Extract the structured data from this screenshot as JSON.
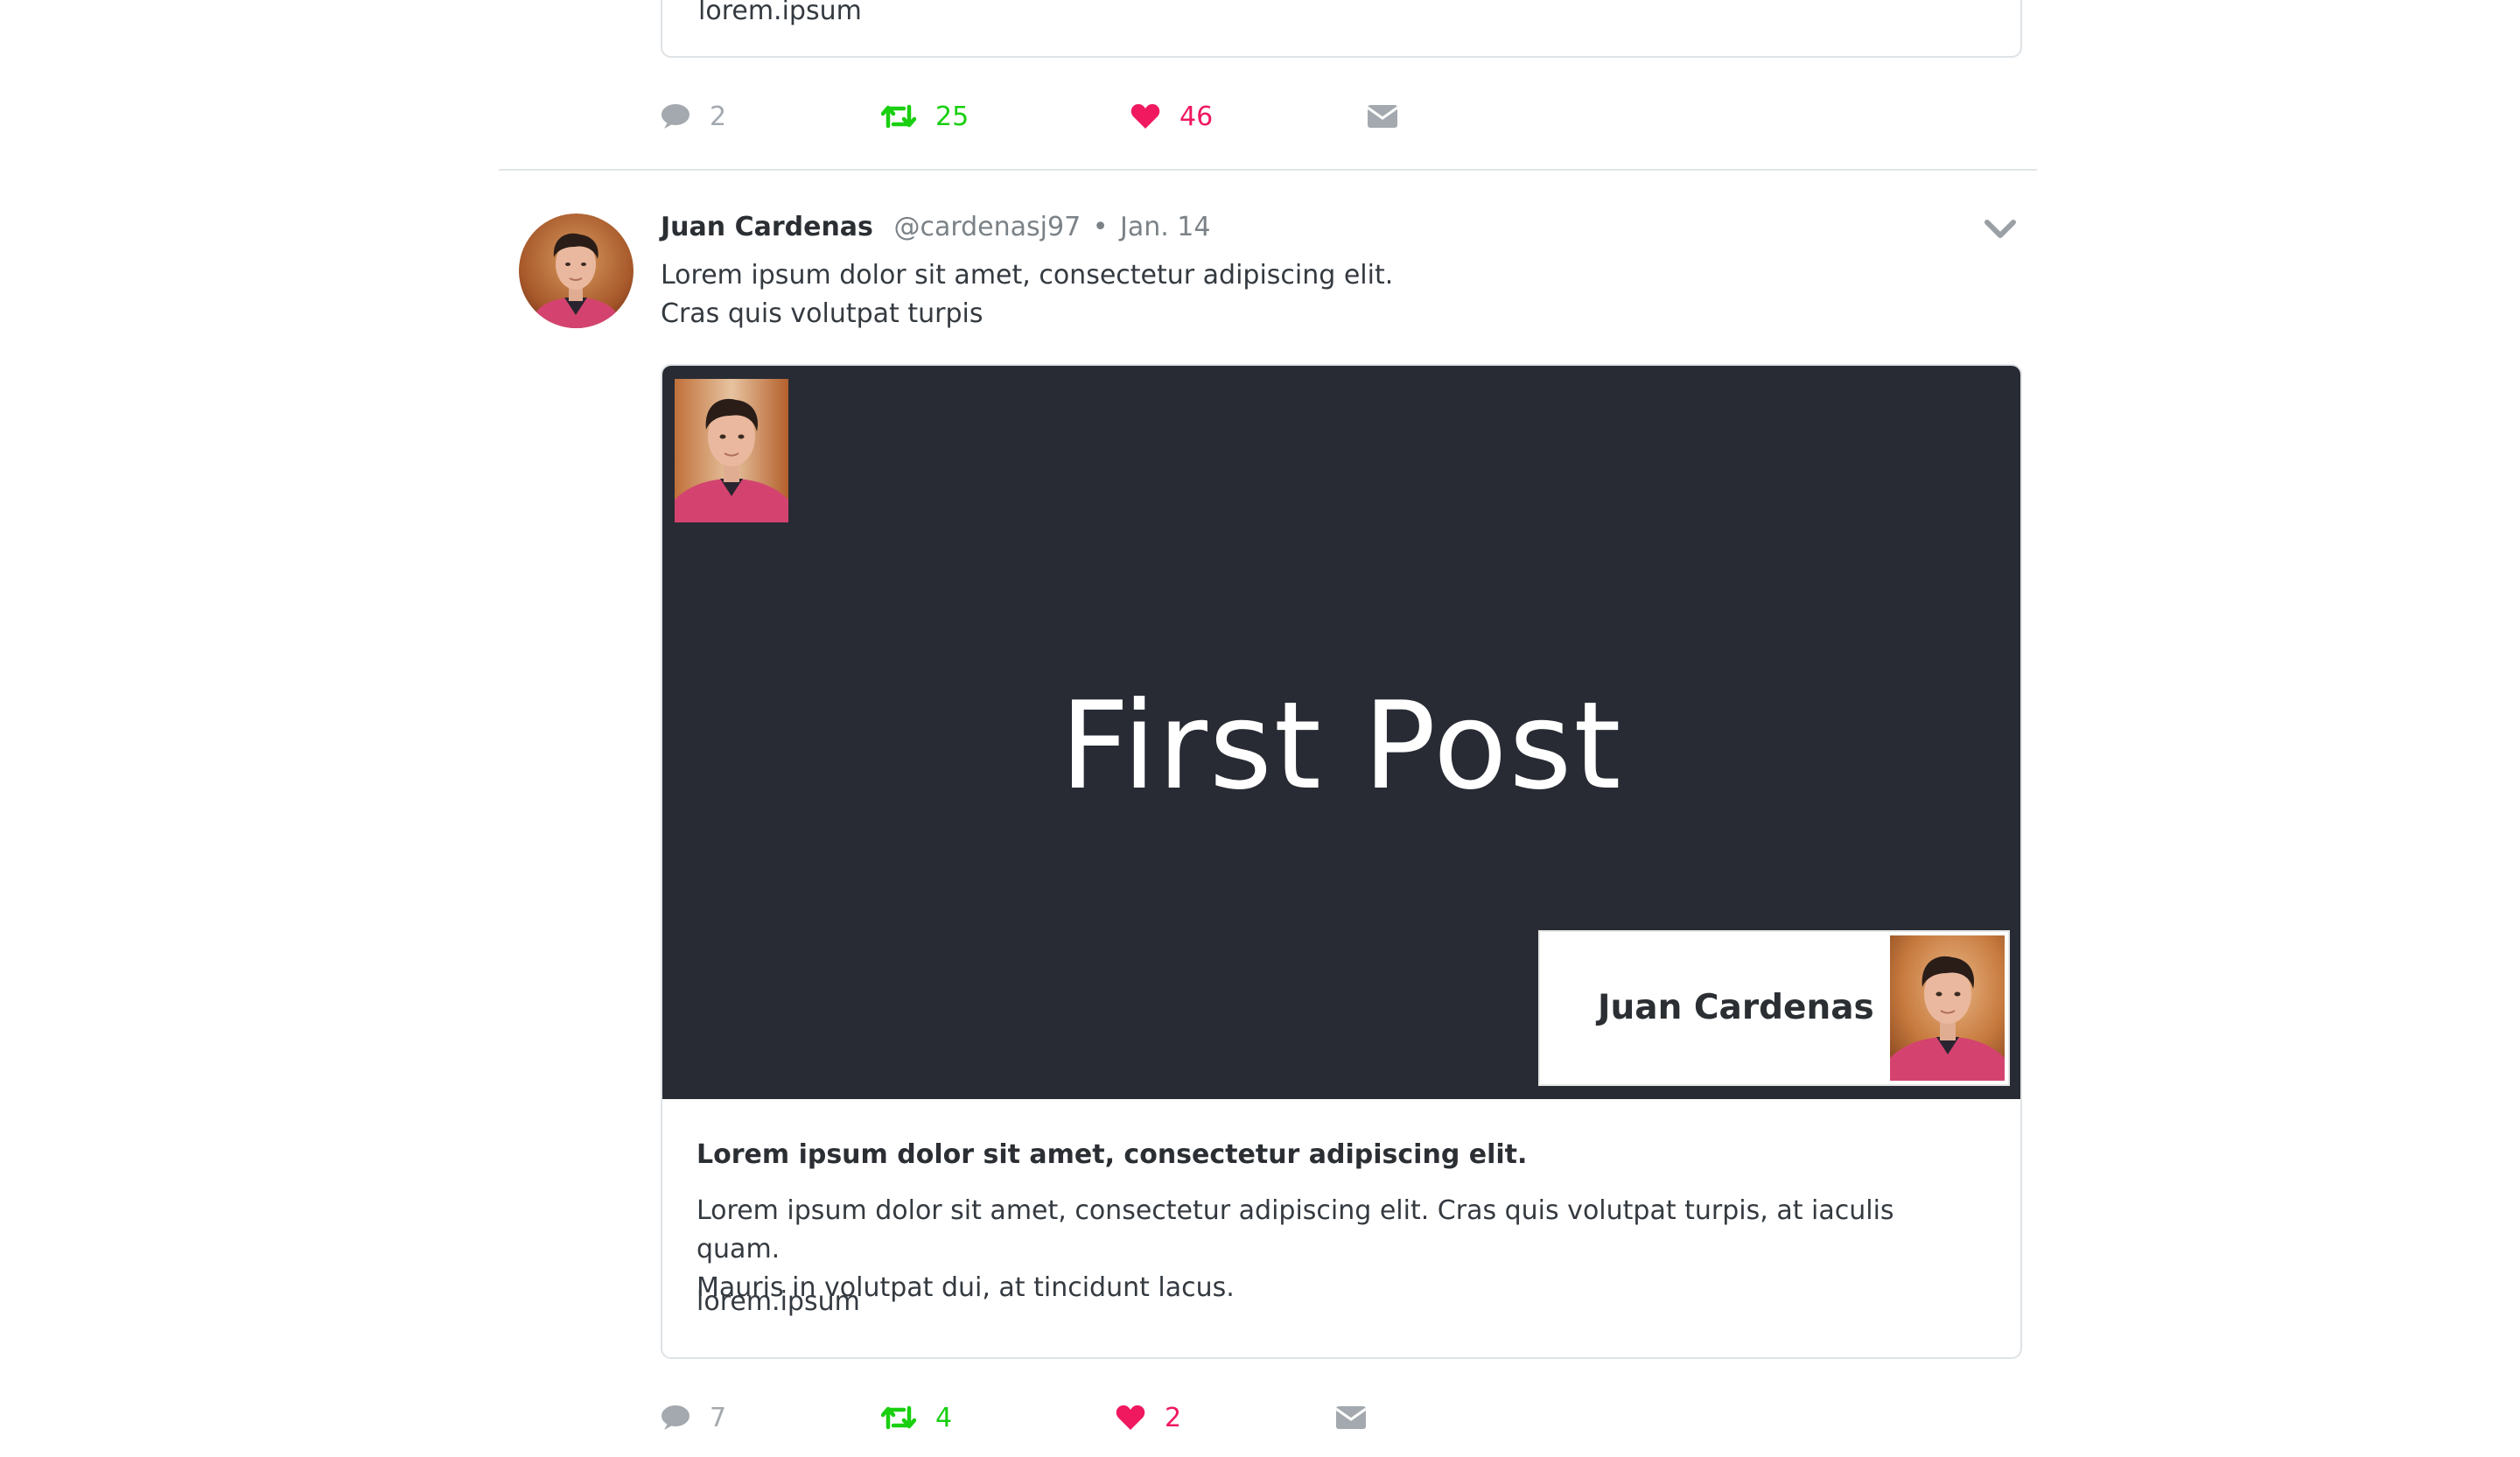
{
  "previous_tweet": {
    "card_link": "lorem.ipsum",
    "actions": {
      "replies": "2",
      "retweets": "25",
      "likes": "46"
    }
  },
  "tweet": {
    "author_name": "Juan Cardenas",
    "handle": "@cardenasj97",
    "separator": "•",
    "date": "Jan. 14",
    "text_line1": "Lorem ipsum dolor sit amet, consectetur adipiscing elit.",
    "text_line2": "Cras quis volutpat turpis",
    "card": {
      "slide_title": "First Post",
      "slide_author": "Juan Cardenas",
      "title": "Lorem ipsum dolor sit amet, consectetur adipiscing elit.",
      "description_line1": "Lorem ipsum dolor sit amet, consectetur adipiscing elit. Cras quis volutpat turpis, at iaculis quam.",
      "description_line2": "Mauris in volutpat dui, at tincidunt lacus.",
      "link": "lorem.ipsum"
    },
    "actions": {
      "replies": "7",
      "retweets": "4",
      "likes": "2"
    }
  },
  "colors": {
    "retweet": "#19cf10",
    "like": "#f0185f",
    "muted": "#a3a9ae",
    "slide_background": "#282b33"
  },
  "icons": [
    "comment-icon",
    "retweet-icon",
    "heart-icon",
    "envelope-icon",
    "chevron-down-icon"
  ]
}
